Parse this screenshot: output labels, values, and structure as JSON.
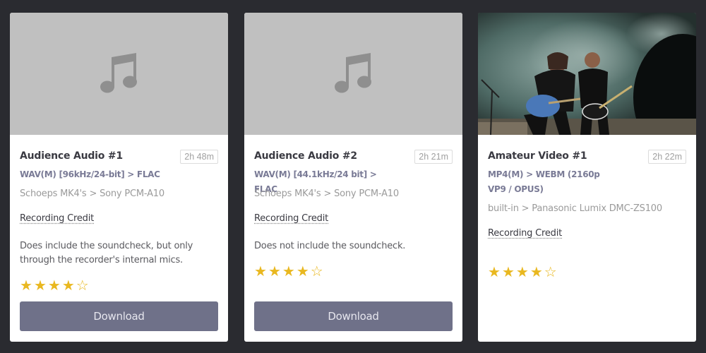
{
  "colors": {
    "page_bg": "#2a2b30",
    "card_bg": "#ffffff",
    "thumb_placeholder": "#c0c0c0",
    "format_text": "#7a7b96",
    "star": "#e9b820",
    "download_button": "#6f7189"
  },
  "cards": [
    {
      "thumbnail_icon": "music-note-icon",
      "title": "Audience Audio #1",
      "duration": "2h 48m",
      "format": "WAV(M) [96kHz/24-bit] > FLAC",
      "chain": "Schoeps MK4's > Sony PCM-A10",
      "credit_label": "Recording Credit",
      "notes": "Does include the soundcheck, but only through the recorder's internal mics.",
      "rating": 4,
      "rating_max": 5,
      "download_label": "Download"
    },
    {
      "thumbnail_icon": "music-note-icon",
      "title": "Audience Audio #2",
      "duration": "2h 21m",
      "format": "WAV(M) [44.1kHz/24 bit] > FLAC",
      "chain": "Schoeps MK4's > Sony PCM-A10",
      "credit_label": "Recording Credit",
      "notes": "Does not include the soundcheck.",
      "rating": 4,
      "rating_max": 5,
      "download_label": "Download"
    },
    {
      "thumbnail_icon": "concert-photo",
      "title": "Amateur Video #1",
      "duration": "2h 22m",
      "format": "MP4(M) > WEBM (2160p VP9 / OPUS)",
      "chain": "built-in > Panasonic Lumix DMC-ZS100",
      "credit_label": "Recording Credit",
      "rating": 4,
      "rating_max": 5
    }
  ]
}
